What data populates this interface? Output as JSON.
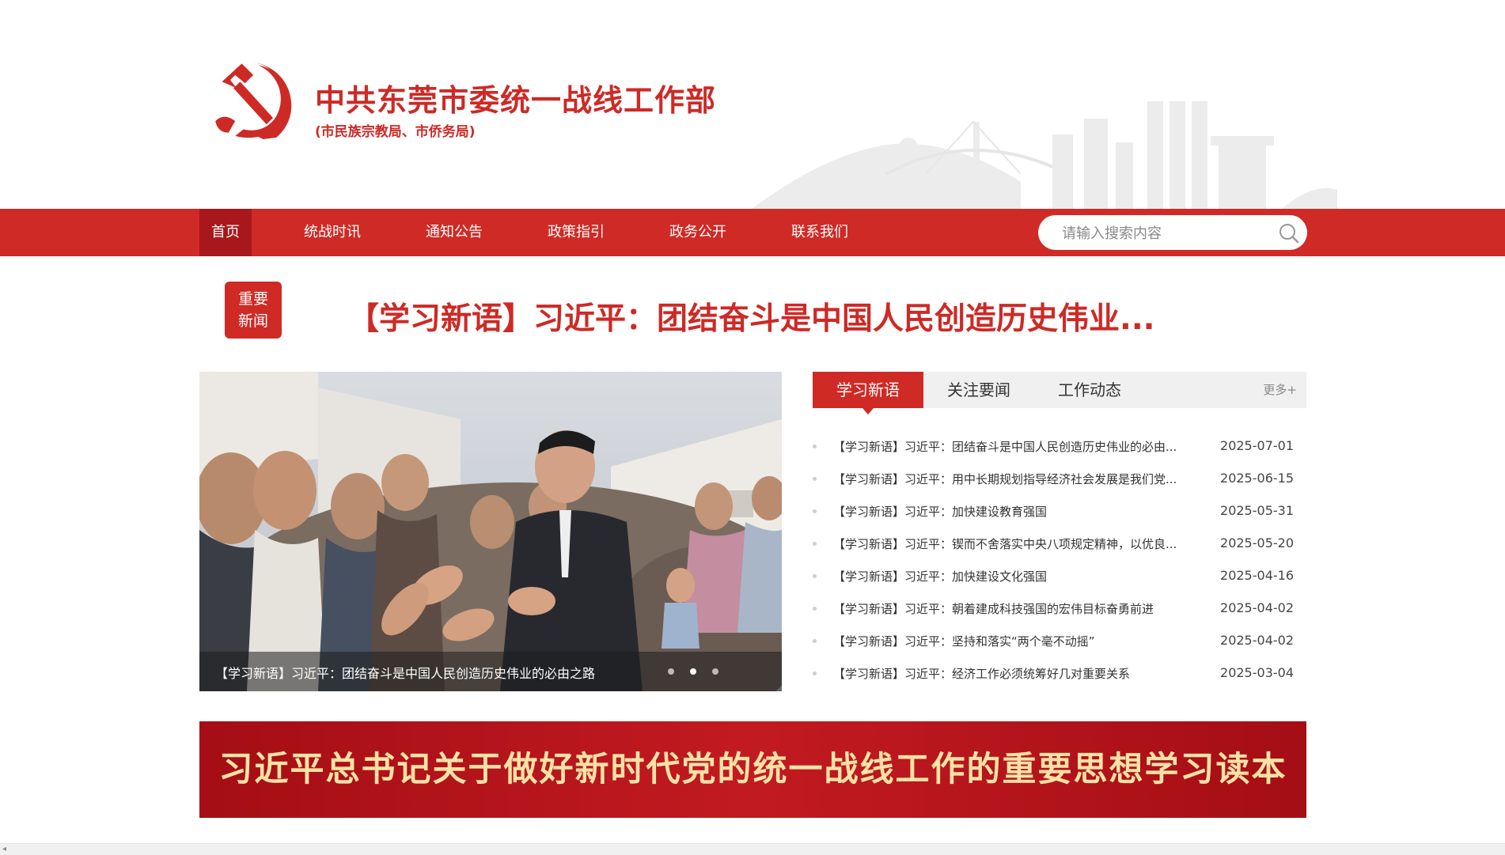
{
  "header": {
    "org_title": "中共东莞市委统一战线工作部",
    "org_subtitle": "(市民族宗教局、市侨务局)",
    "logo_icon": "hammer-sickle-icon"
  },
  "nav": {
    "items": [
      {
        "label": "首页",
        "active": true
      },
      {
        "label": "统战时讯"
      },
      {
        "label": "通知公告"
      },
      {
        "label": "政策指引"
      },
      {
        "label": "政务公开"
      },
      {
        "label": "联系我们"
      }
    ],
    "search": {
      "placeholder": "请输入搜索内容",
      "icon": "search-icon"
    }
  },
  "headline": {
    "badge_line1": "重要",
    "badge_line2": "新闻",
    "text": "【学习新语】习近平：团结奋斗是中国人民创造历史伟业..."
  },
  "carousel": {
    "caption": "【学习新语】习近平：团结奋斗是中国人民创造历史伟业的必由之路",
    "slide_count": 3,
    "active_index": 1
  },
  "news_panel": {
    "tabs": [
      {
        "label": "学习新语",
        "active": true
      },
      {
        "label": "关注要闻"
      },
      {
        "label": "工作动态"
      }
    ],
    "more_label": "更多+",
    "items": [
      {
        "title": "【学习新语】习近平：团结奋斗是中国人民创造历史伟业的必由...",
        "date": "2025-07-01"
      },
      {
        "title": "【学习新语】习近平：用中长期规划指导经济社会发展是我们党...",
        "date": "2025-06-15"
      },
      {
        "title": "【学习新语】习近平：加快建设教育强国",
        "date": "2025-05-31"
      },
      {
        "title": "【学习新语】习近平：锲而不舍落实中央八项规定精神，以优良...",
        "date": "2025-05-20"
      },
      {
        "title": "【学习新语】习近平：加快建设文化强国",
        "date": "2025-04-16"
      },
      {
        "title": "【学习新语】习近平：朝着建成科技强国的宏伟目标奋勇前进",
        "date": "2025-04-02"
      },
      {
        "title": "【学习新语】习近平：坚持和落实“两个毫不动摇”",
        "date": "2025-04-02"
      },
      {
        "title": "【学习新语】习近平：经济工作必须统筹好几对重要关系",
        "date": "2025-03-04"
      }
    ]
  },
  "banner": {
    "text": "习近平总书记关于做好新时代党的统一战线工作的重要思想学习读本"
  },
  "colors": {
    "primary_red": "#cf2a25",
    "active_nav": "#a8171c",
    "banner_red": "#b3131b",
    "banner_text": "#fbe2a6"
  }
}
